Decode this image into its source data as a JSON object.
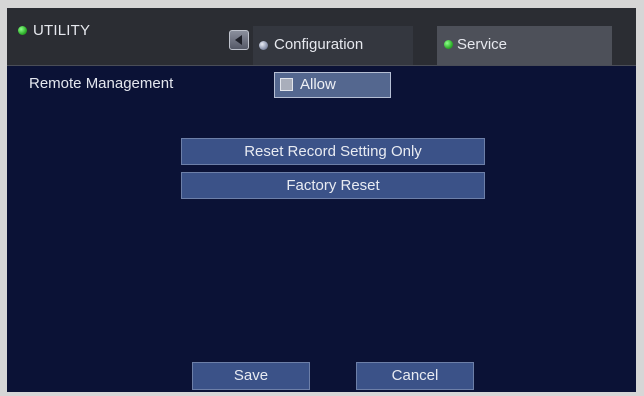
{
  "header": {
    "title": "UTILITY",
    "tabs": [
      {
        "label": "Configuration",
        "status": "inactive"
      },
      {
        "label": "Service",
        "status": "active"
      }
    ]
  },
  "remote_management": {
    "label": "Remote Management",
    "checkbox_label": "Allow",
    "checked": false
  },
  "actions": {
    "reset_record": "Reset Record Setting Only",
    "factory_reset": "Factory Reset"
  },
  "footer": {
    "save_label": "Save",
    "cancel_label": "Cancel"
  },
  "colors": {
    "background": "#0b1236",
    "header": "#2b2d33",
    "button": "#3b5288",
    "active_indicator": "#2fb12b"
  }
}
